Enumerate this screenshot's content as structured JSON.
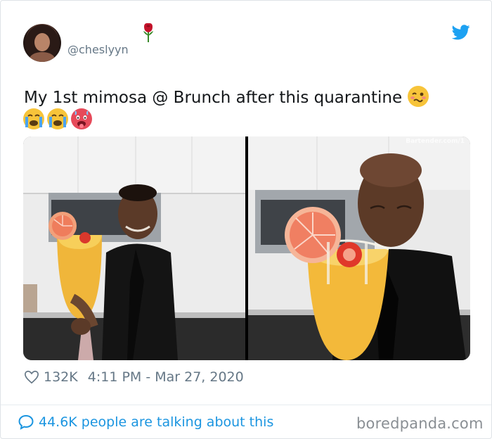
{
  "author": {
    "handle": "@cheslyyn",
    "avatar": "avatar-photo"
  },
  "icons": {
    "rose": "rose-icon",
    "bird": "twitter-bird-icon",
    "heart": "heart-icon",
    "bubble": "speech-bubble-icon"
  },
  "tweet": {
    "text": "My 1st mimosa @ Brunch after this quarantine",
    "emojis": [
      "woozy-face",
      "crying-face",
      "crying-face",
      "hot-face"
    ]
  },
  "media": {
    "watermark": "Bartender.com/1"
  },
  "stats": {
    "likes": "132K",
    "timestamp": "4:11 PM - Mar 27, 2020"
  },
  "footer": {
    "talk_text": "44.6K people are talking about this",
    "brand": "boredpanda.com"
  },
  "colors": {
    "twitter_blue": "#1da1f2",
    "link_blue": "#1b95e0",
    "muted": "#657786"
  }
}
